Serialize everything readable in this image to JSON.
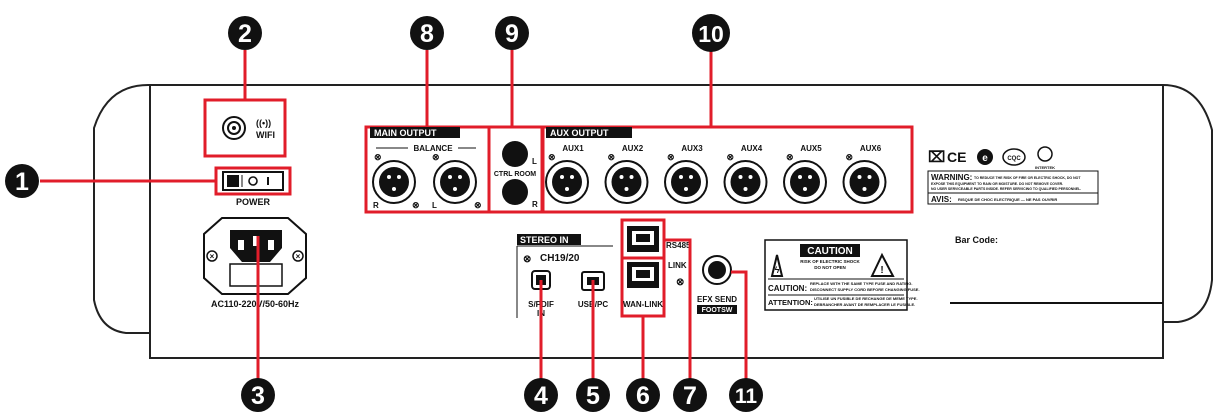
{
  "callouts": [
    "1",
    "2",
    "3",
    "4",
    "5",
    "6",
    "7",
    "8",
    "9",
    "10",
    "11"
  ],
  "labels": {
    "wifi": "WIFI",
    "power": "POWER",
    "ac": "AC110-220V/50-60Hz",
    "main_output": "MAIN OUTPUT",
    "balance": "BALANCE",
    "main_r": "R",
    "main_l": "L",
    "ctrl_room": "CTRL ROOM",
    "ctrl_l": "L",
    "ctrl_r": "R",
    "aux_output": "AUX OUTPUT",
    "aux": [
      "AUX1",
      "AUX2",
      "AUX3",
      "AUX4",
      "AUX5",
      "AUX6"
    ],
    "stereo_in": "STEREO IN",
    "ch": "CH19/20",
    "spdif_1": "S/PDIF",
    "spdif_2": "IN",
    "usb": "USB/PC",
    "wan": "WAN-LINK",
    "rs485": "RS485",
    "link": "LINK",
    "efx_send": "EFX SEND",
    "footsw": "FOOTSW",
    "caution": "CAUTION",
    "caution_sub1": "RISK OF ELECTRIC SHOCK",
    "caution_sub2": "DO NOT OPEN",
    "caution_line_head": "CAUTION:",
    "caution_line_1": "REPLACE WITH THE SAME TYPE FUSE AND RATING.",
    "caution_line_2": "DISCONNECT SUPPLY CORD BEFORE CHANGING FUSE.",
    "attention_head": "ATTENTION:",
    "attention_1": "UTILISE UN FUSIBLE DE RECHANGE DE MEME TYPE.",
    "attention_2": "DEBRANCHER AVANT DE REMPLACER LE FUSIBLE.",
    "warning_head": "WARNING:",
    "warning_1": "TO REDUCE THE RISK OF FIRE OR ELECTRIC SHOCK, DO NOT",
    "warning_2": "EXPOSE THIS EQUIPMENT TO RAIN OR MOISTURE. DO NOT REMOVE COVER.",
    "warning_3": "NO USER SERVICEABLE PARTS INSIDE. REFER SERVICING TO QUALIFIED PERSONNEL.",
    "avis_head": "AVIS:",
    "avis_1": "RISQUE DE CHOC ELECTRIQUE — NE PAS OUVRIR",
    "bar_code": "Bar Code:",
    "intertek": "INTERTEK",
    "cqc": "CQC",
    "ce": "CE"
  },
  "colors": {
    "callout_red": "#e11d2a",
    "badge": "#111111",
    "panel_line": "#222222"
  }
}
